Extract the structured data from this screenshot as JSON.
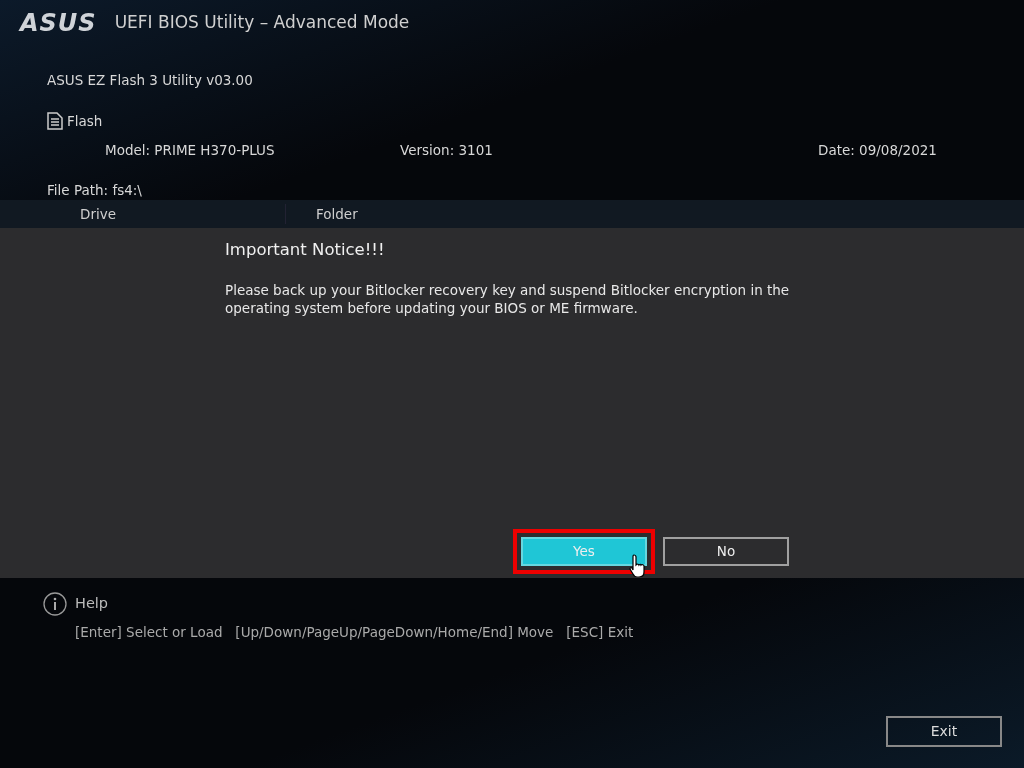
{
  "header": {
    "logo": "ASUS",
    "title": "UEFI BIOS Utility – Advanced Mode"
  },
  "utility": {
    "name": "ASUS EZ Flash 3 Utility v03.00",
    "section": "Flash",
    "model": "Model:  PRIME H370-PLUS",
    "version": "Version:  3101",
    "date": "Date: 09/08/2021",
    "file_path": "File Path: fs4:\\"
  },
  "table": {
    "columns": [
      "Drive",
      "Folder"
    ]
  },
  "dialog": {
    "title": "Important Notice!!!",
    "message": "Please back up your Bitlocker recovery key and suspend Bitlocker encryption in the operating system before updating your BIOS or ME firmware.",
    "buttons": [
      {
        "label": "Yes",
        "selected": true
      },
      {
        "label": "No",
        "selected": false
      }
    ]
  },
  "help": {
    "title": "Help",
    "keys": "[Enter] Select or Load   [Up/Down/PageUp/PageDown/Home/End] Move   [ESC] Exit"
  },
  "footer": {
    "exit": "Exit"
  }
}
